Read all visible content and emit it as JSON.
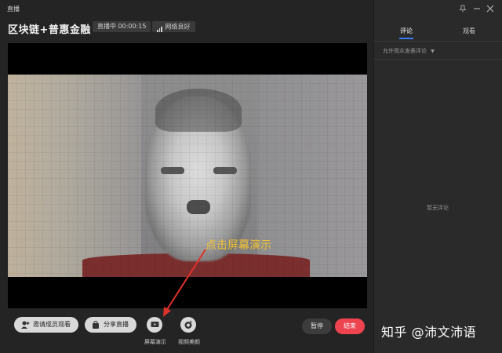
{
  "window": {
    "title": "直播"
  },
  "header": {
    "session_title": "区块链+普惠金融",
    "live_status": "直播中 00:00:15",
    "network_status": "网络良好"
  },
  "video": {
    "annotation_text": "点击屏幕演示"
  },
  "controls": {
    "invite_label": "邀请成员观看",
    "share_label": "分享直播",
    "screen_share_label": "屏幕演示",
    "beauty_label": "视频美颜",
    "pause_label": "暂停",
    "end_label": "结束"
  },
  "side_panel": {
    "tabs": [
      {
        "label": "评论",
        "active": true
      },
      {
        "label": "观看",
        "active": false
      }
    ],
    "comment_setting": "允许观众发表评论",
    "empty_comments": "暂无评论"
  },
  "watermark": "知乎 @沛文沛语",
  "colors": {
    "accent": "#3b7cf6",
    "end_button": "#ee4450",
    "annotation": "#f1c232",
    "annotation_arrow": "#e0322c"
  },
  "icons": {
    "pin": "pin-icon",
    "minimize": "minimize-icon",
    "close": "close-icon",
    "invite": "add-person-icon",
    "share": "share-bag-icon",
    "screen_share": "screen-play-icon",
    "beauty": "camera-face-icon",
    "signal": "signal-bars-icon",
    "dropdown": "caret-down-icon"
  }
}
